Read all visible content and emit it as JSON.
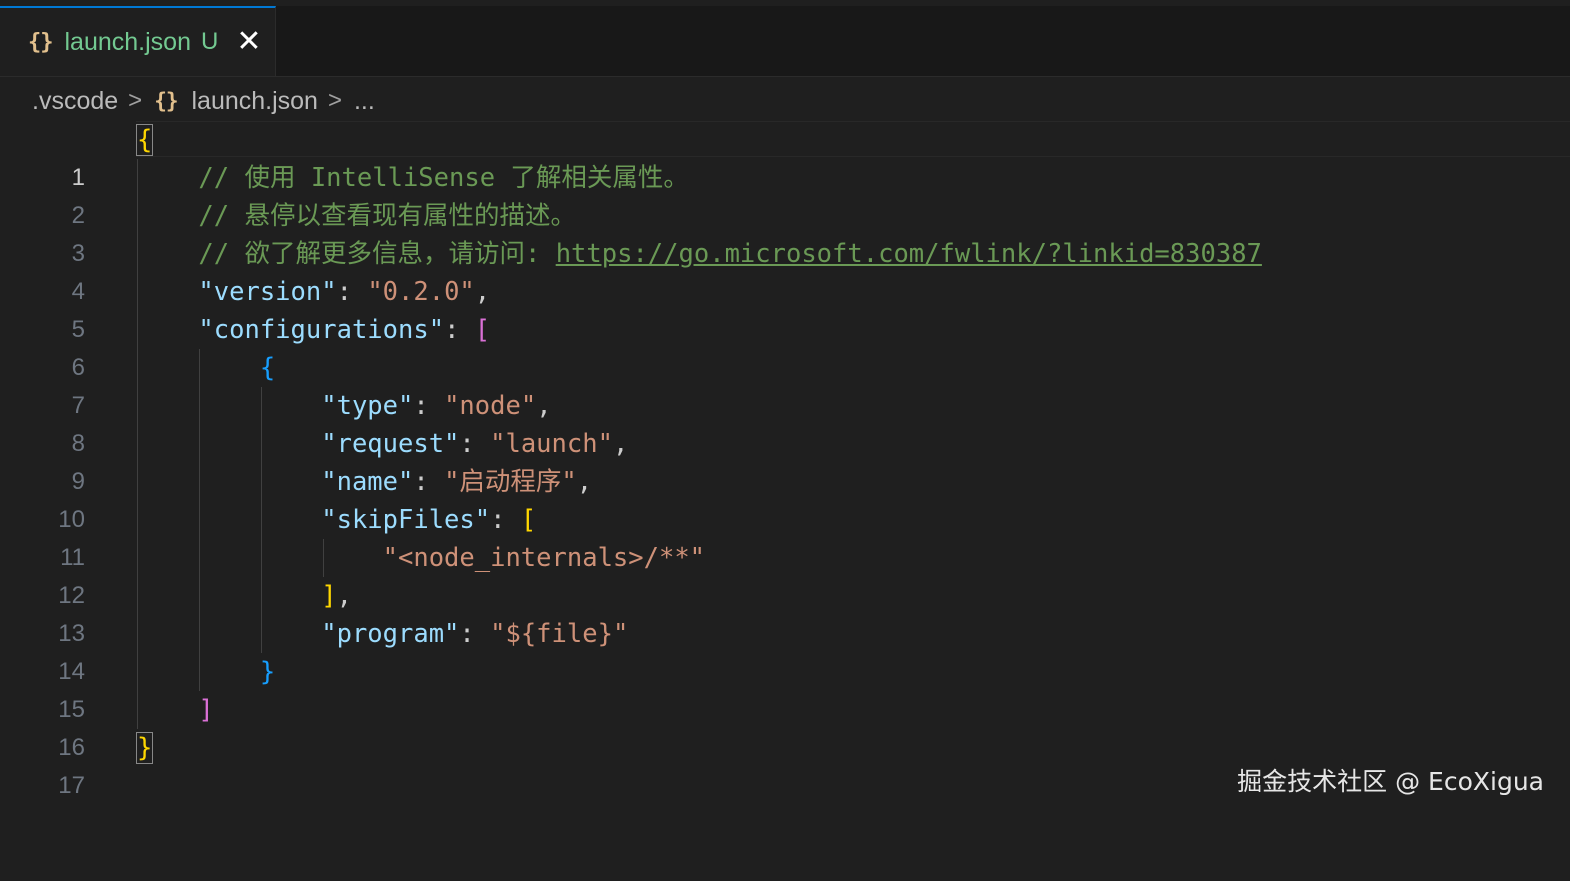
{
  "tab": {
    "icon": "{}",
    "filename": "launch.json",
    "status": "U",
    "close": "✕"
  },
  "breadcrumb": {
    "folder": ".vscode",
    "icon": "{}",
    "file": "launch.json",
    "more": "..."
  },
  "editor": {
    "active_line": 1,
    "line_numbers": [
      "1",
      "2",
      "3",
      "4",
      "5",
      "6",
      "7",
      "8",
      "9",
      "10",
      "11",
      "12",
      "13",
      "14",
      "15",
      "16",
      "17"
    ],
    "lines": {
      "l2_comment": "// 使用 IntelliSense 了解相关属性。",
      "l3_comment": "// 悬停以查看现有属性的描述。",
      "l4_comment_prefix": "// 欲了解更多信息，请访问: ",
      "l4_link": "https://go.microsoft.com/fwlink/?linkid=830387",
      "version_key": "\"version\"",
      "version_value": "\"0.2.0\"",
      "configurations_key": "\"configurations\"",
      "type_key": "\"type\"",
      "type_value": "\"node\"",
      "request_key": "\"request\"",
      "request_value": "\"launch\"",
      "name_key": "\"name\"",
      "name_value": "\"启动程序\"",
      "skipfiles_key": "\"skipFiles\"",
      "skipfiles_item": "\"<node_internals>/**\"",
      "program_key": "\"program\"",
      "program_value": "\"${file}\""
    }
  },
  "watermark": "掘金技术社区 @ EcoXigua",
  "colors": {
    "comment": "#6a9955",
    "key": "#9cdcfe",
    "string": "#ce9178",
    "bracket_level1": "#ffd700",
    "bracket_level2": "#da70d6",
    "bracket_level3": "#179fff",
    "tab_modified": "#73c991"
  }
}
